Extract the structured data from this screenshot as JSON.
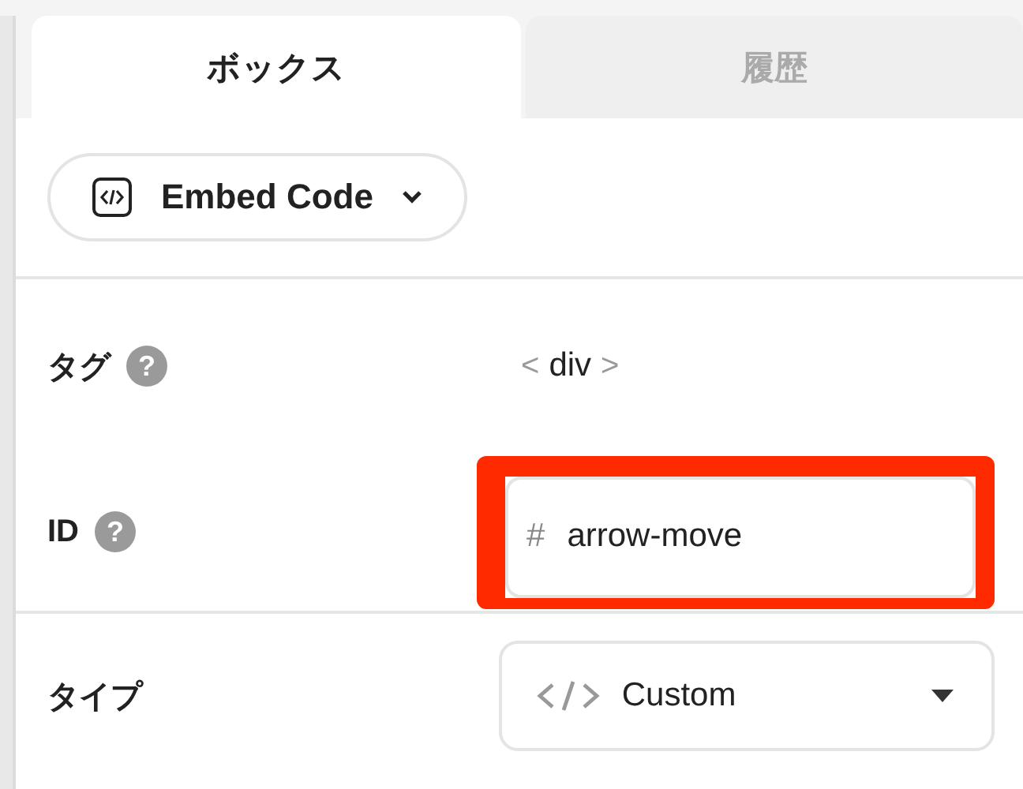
{
  "tabs": [
    {
      "label": "ボックス",
      "selected": true
    },
    {
      "label": "履歴",
      "selected": false
    }
  ],
  "element_button": {
    "label": "Embed Code"
  },
  "fields": [
    {
      "kind": "tag",
      "label": "タグ",
      "help": "?",
      "open": "<",
      "value": "div",
      "close": ">"
    },
    {
      "kind": "input",
      "label": "ID",
      "help": "?",
      "prefix": "#",
      "value": "arrow-move",
      "highlighted": true
    },
    {
      "kind": "select",
      "label": "タイプ",
      "value": "Custom"
    }
  ]
}
